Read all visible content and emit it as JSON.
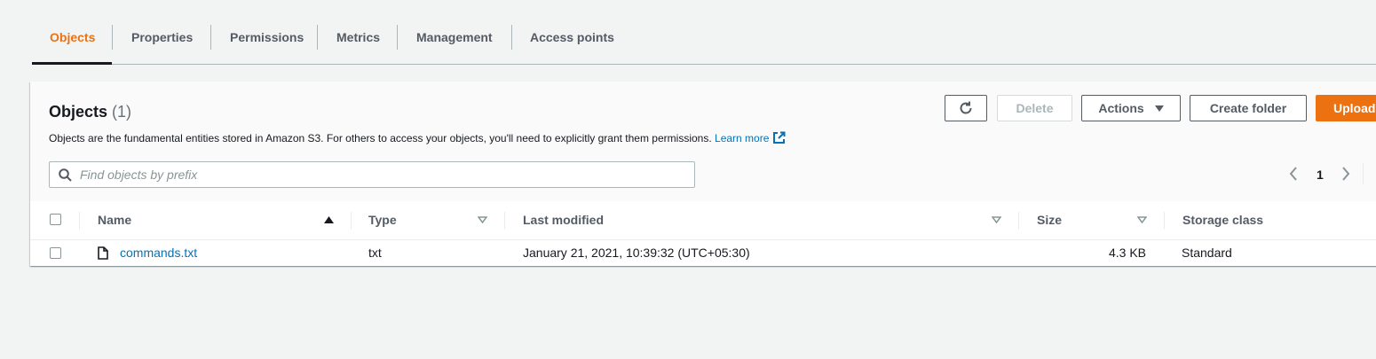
{
  "tabs": [
    {
      "label": "Objects",
      "active": true
    },
    {
      "label": "Properties"
    },
    {
      "label": "Permissions"
    },
    {
      "label": "Metrics"
    },
    {
      "label": "Management"
    },
    {
      "label": "Access points"
    }
  ],
  "panel": {
    "title": "Objects",
    "count": "(1)",
    "description": "Objects are the fundamental entities stored in Amazon S3. For others to access your objects, you'll need to explicitly grant them permissions.",
    "learn_more": "Learn more"
  },
  "toolbar": {
    "refresh_icon": "refresh-icon",
    "delete_label": "Delete",
    "actions_label": "Actions",
    "create_folder_label": "Create folder",
    "upload_label": "Upload",
    "accent_color": "#ec7211"
  },
  "search": {
    "placeholder": "Find objects by prefix",
    "value": ""
  },
  "pagination": {
    "current_page": "1"
  },
  "table": {
    "columns": [
      "Name",
      "Type",
      "Last modified",
      "Size",
      "Storage class"
    ],
    "rows": [
      {
        "name": "commands.txt",
        "type": "txt",
        "last_modified": "January 21, 2021, 10:39:32 (UTC+05:30)",
        "size": "4.3 KB",
        "storage_class": "Standard"
      }
    ]
  }
}
